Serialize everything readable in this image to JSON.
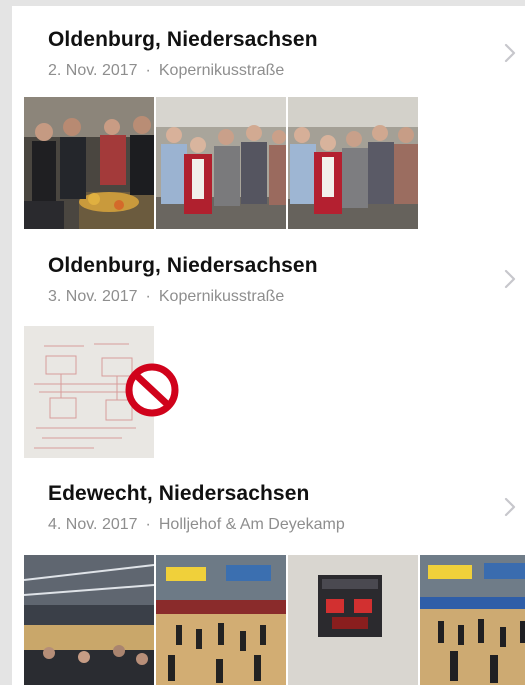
{
  "moments": [
    {
      "place": "Oldenburg, Niedersachsen",
      "date": "2. Nov. 2017",
      "separator": "·",
      "location": "Kopernikusstraße",
      "chevron_icon": "chevron-right-icon",
      "photos": [
        "group-at-food-table-photo",
        "four-people-posing-photo",
        "five-people-posing-photo"
      ]
    },
    {
      "place": "Oldenburg, Niedersachsen",
      "date": "3. Nov. 2017",
      "separator": "·",
      "location": "Kopernikusstraße",
      "chevron_icon": "chevron-right-icon",
      "photos": [
        "whiteboard-sketch-photo"
      ],
      "overlay_icon": "prohibited-icon"
    },
    {
      "place": "Edewecht, Niedersachsen",
      "date": "4. Nov. 2017",
      "separator": "·",
      "location": "Holljehof & Am Deyekamp",
      "chevron_icon": "chevron-right-icon",
      "photos": [
        "sports-hall-crowd-photo",
        "sports-hall-court-photo",
        "scoreboard-photo",
        "sports-hall-players-photo"
      ]
    }
  ],
  "colors": {
    "title": "#111111",
    "subtitle": "#8e8e8e",
    "chevron": "#c7c7cc",
    "prohibited": "#d0021b"
  }
}
